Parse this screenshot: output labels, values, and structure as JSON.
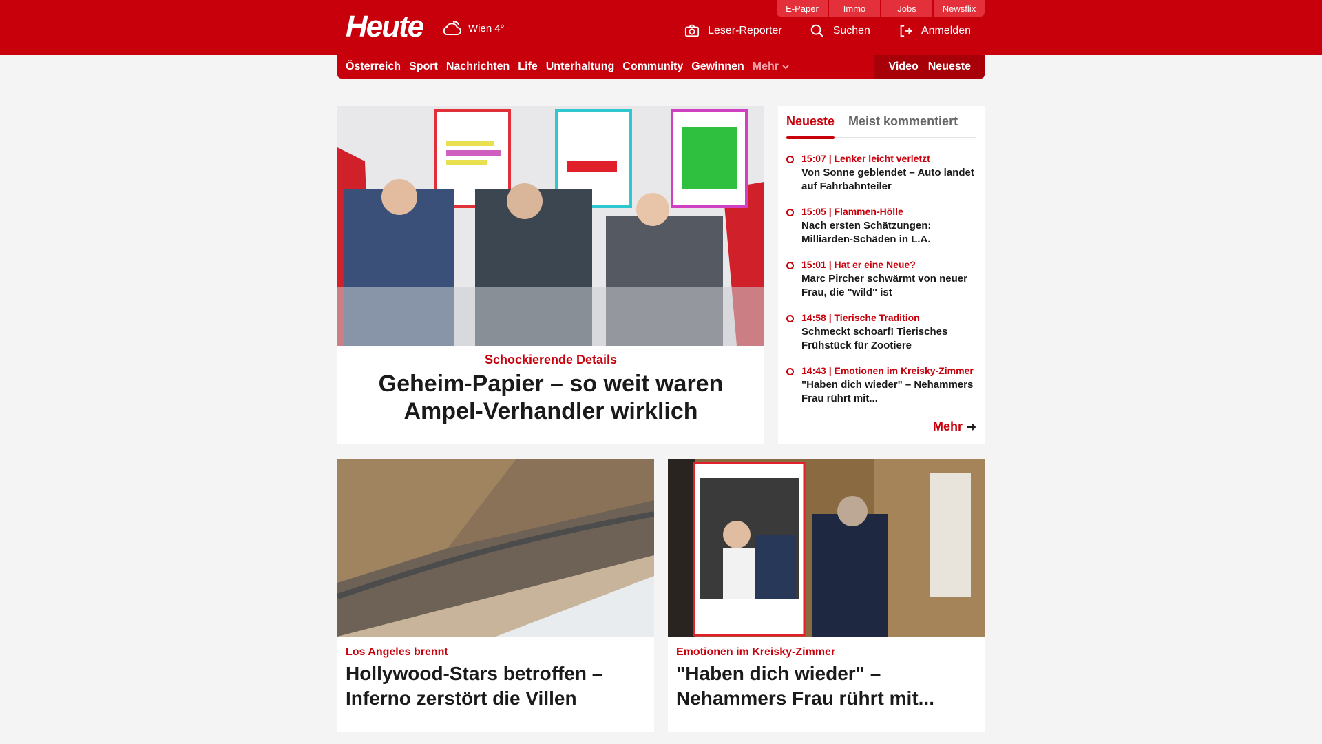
{
  "brand": {
    "logo": "Heute",
    "weather": "Wien 4°",
    "accent": "#c8000c"
  },
  "top_links": [
    "E-Paper",
    "Immo",
    "Jobs",
    "Newsflix"
  ],
  "actions": {
    "reporter": "Leser-Reporter",
    "search": "Suchen",
    "login": "Anmelden"
  },
  "nav": {
    "items": [
      "Österreich",
      "Sport",
      "Nachrichten",
      "Life",
      "Unterhaltung",
      "Community",
      "Gewinnen"
    ],
    "more": "Mehr",
    "video": "Video",
    "latest": "Neueste"
  },
  "hero": {
    "kicker": "Schockierende Details",
    "title": "Geheim-Papier – so weit waren Ampel-Verhandler wirklich"
  },
  "sidebar": {
    "tabs": [
      "Neueste",
      "Meist kommentiert"
    ],
    "items": [
      {
        "meta": "15:07 | Lenker leicht verletzt",
        "title": "Von Sonne geblendet – Auto landet auf Fahrbahnteiler"
      },
      {
        "meta": "15:05 | Flammen-Hölle",
        "title": "Nach ersten Schätzungen: Milliarden-Schäden in L.A."
      },
      {
        "meta": "15:01 | Hat er eine Neue?",
        "title": "Marc Pircher schwärmt von neuer Frau, die \"wild\" ist"
      },
      {
        "meta": "14:58 | Tierische Tradition",
        "title": "Schmeckt schoarf! Tierisches Frühstück für Zootiere"
      },
      {
        "meta": "14:43 | Emotionen im Kreisky-Zimmer",
        "title": "\"Haben dich wieder\" – Nehammers Frau rührt mit..."
      }
    ],
    "more": "Mehr"
  },
  "cards": [
    {
      "kicker": "Los Angeles brennt",
      "title": "Hollywood-Stars betroffen – Inferno zerstört die Villen"
    },
    {
      "kicker": "Emotionen im Kreisky-Zimmer",
      "title": "\"Haben dich wieder\" – Nehammers Frau rührt mit..."
    }
  ]
}
